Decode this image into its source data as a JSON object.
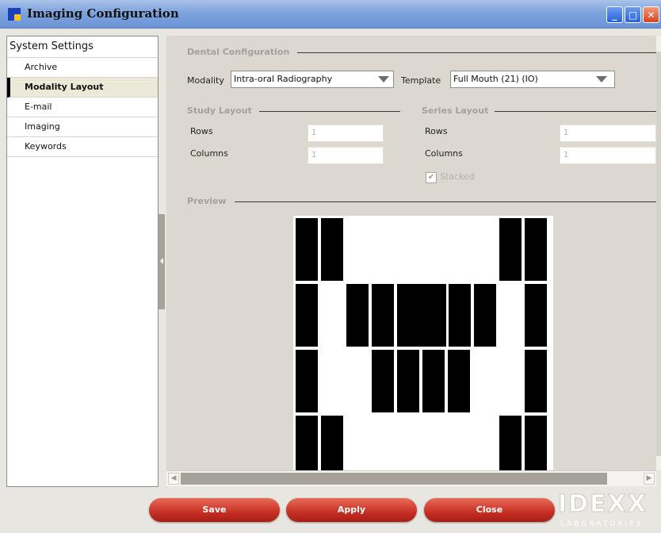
{
  "window": {
    "title": "Imaging Configuration",
    "controls": {
      "minimize": "_",
      "maximize": "□",
      "close": "✕"
    }
  },
  "sidebar": {
    "header": "System Settings",
    "items": [
      {
        "label": "Archive"
      },
      {
        "label": "Modality Layout",
        "active": true
      },
      {
        "label": "E-mail"
      },
      {
        "label": "Imaging"
      },
      {
        "label": "Keywords"
      }
    ]
  },
  "dental": {
    "section_title": "Dental Configuration",
    "modality_label": "Modality",
    "modality_value": "Intra-oral Radiography",
    "template_label": "Template",
    "template_value": "Full Mouth (21) (IO)"
  },
  "study_layout": {
    "section_title": "Study Layout",
    "rows_label": "Rows",
    "rows_value": "1",
    "columns_label": "Columns",
    "columns_value": "1"
  },
  "series_layout": {
    "section_title": "Series Layout",
    "rows_label": "Rows",
    "rows_value": "1",
    "columns_label": "Columns",
    "columns_value": "1",
    "stacked_label": "Stacked",
    "stacked_checked": true
  },
  "preview": {
    "section_title": "Preview"
  },
  "buttons": {
    "save": "Save",
    "apply": "Apply",
    "close": "Close"
  },
  "logo": {
    "brand": "IDEXX",
    "sub": "LABORATORIES"
  },
  "colors": {
    "button_red": "#c62f24",
    "titlebar_blue": "#7ea3dc",
    "section_gray": "#a5a19a"
  }
}
